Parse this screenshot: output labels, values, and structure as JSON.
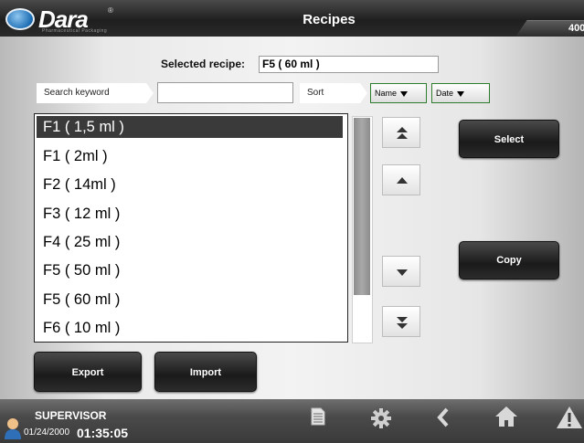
{
  "header": {
    "brand": "Dara",
    "registered_mark": "®",
    "tagline": "Pharmaceutical Packaging",
    "title": "Recipes",
    "code": "400"
  },
  "selected_recipe": {
    "label": "Selected recipe:",
    "value": "F5 ( 60 ml )"
  },
  "search": {
    "label": "Search keyword",
    "value": ""
  },
  "sort": {
    "label": "Sort",
    "options": [
      "Name",
      "Date"
    ]
  },
  "recipes": [
    "F1 ( 1,5 ml )",
    "F1 ( 2ml )",
    "F2 ( 14ml )",
    "F3 ( 12 ml )",
    "F4 ( 25 ml )",
    "F5 ( 50 ml )",
    "F5 ( 60 ml )",
    "F6 ( 10 ml )"
  ],
  "selected_index": 0,
  "buttons": {
    "select": "Select",
    "copy": "Copy",
    "export": "Export",
    "import": "Import"
  },
  "navigation_icons": [
    "double-up-arrow-icon",
    "up-arrow-icon",
    "down-arrow-icon",
    "double-down-arrow-icon"
  ],
  "status": {
    "user": "SUPERVISOR",
    "date": "01/24/2000",
    "time": "01:35:05",
    "icons": [
      "document-icon",
      "gear-icon",
      "back-icon",
      "home-icon",
      "alarm-icon"
    ]
  }
}
